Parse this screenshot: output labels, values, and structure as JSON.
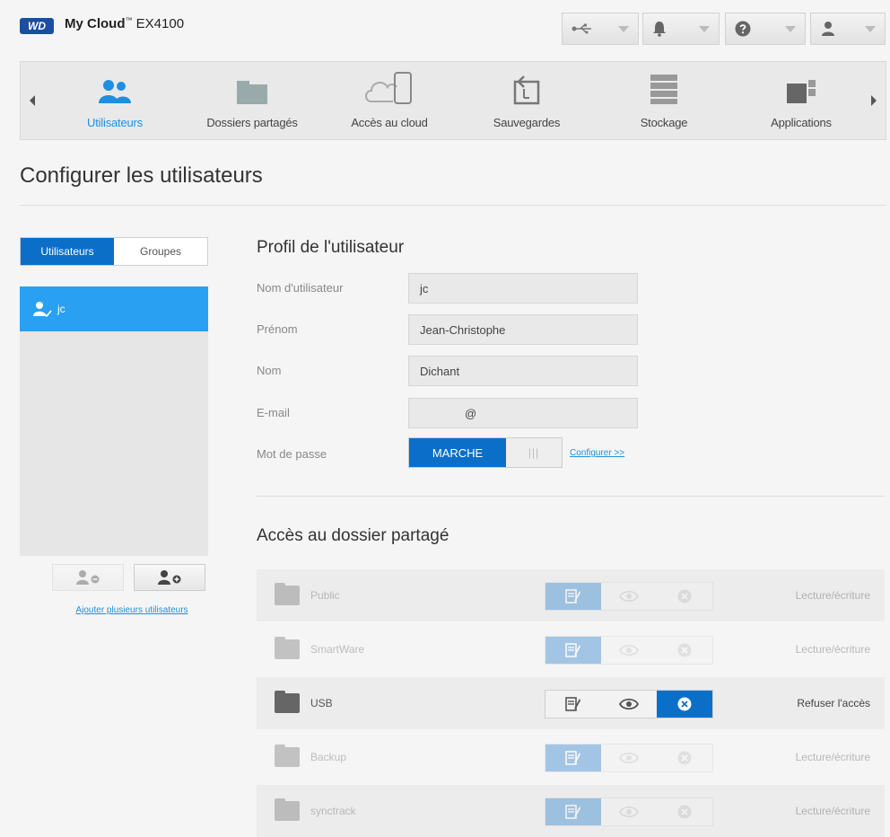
{
  "header": {
    "logo_text": "WD",
    "app_name": "My Cloud",
    "trademark": "™",
    "model": "EX4100",
    "icons": [
      "usb-icon",
      "bell-icon",
      "help-icon",
      "user-icon"
    ]
  },
  "nav": {
    "items": [
      {
        "label": "Utilisateurs",
        "icon": "users-icon",
        "active": true
      },
      {
        "label": "Dossiers partagés",
        "icon": "folder-icon",
        "active": false
      },
      {
        "label": "Accès au cloud",
        "icon": "cloud-icon",
        "active": false
      },
      {
        "label": "Sauvegardes",
        "icon": "backup-icon",
        "active": false
      },
      {
        "label": "Stockage",
        "icon": "storage-icon",
        "active": false
      },
      {
        "label": "Applications",
        "icon": "apps-icon",
        "active": false
      }
    ]
  },
  "page": {
    "title": "Configurer les utilisateurs"
  },
  "sidebar": {
    "tabs": [
      "Utilisateurs",
      "Groupes"
    ],
    "users": [
      {
        "name": "jc"
      }
    ],
    "add_many_link": "Ajouter plusieurs utilisateurs"
  },
  "profile": {
    "title": "Profil de l'utilisateur",
    "username_label": "Nom d'utilisateur",
    "username": "jc",
    "firstname_label": "Prénom",
    "firstname": "Jean-Christophe",
    "lastname_label": "Nom",
    "lastname": "Dichant",
    "email_label": "E-mail",
    "email": "@",
    "password_label": "Mot de passe",
    "password_toggle": "MARCHE",
    "password_grip": "|||",
    "configure_link": "Configurer >>"
  },
  "shares": {
    "title": "Accès au dossier partagé",
    "rows": [
      {
        "name": "Public",
        "access": "Lecture/écriture",
        "faded": true
      },
      {
        "name": "SmartWare",
        "access": "Lecture/écriture",
        "faded": true
      },
      {
        "name": "USB",
        "access": "Refuser l'accès",
        "faded": false
      },
      {
        "name": "Backup",
        "access": "Lecture/écriture",
        "faded": true
      },
      {
        "name": "synctrack",
        "access": "Lecture/écriture",
        "faded": true
      }
    ]
  },
  "colors": {
    "accent": "#0b6fc8",
    "selected_row": "#29a0f1",
    "link": "#1e8fe1"
  }
}
